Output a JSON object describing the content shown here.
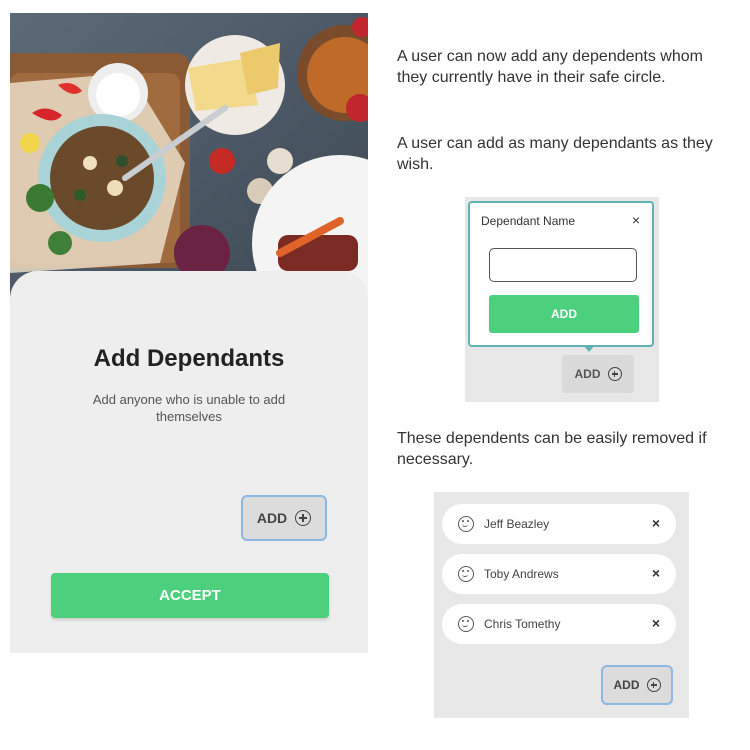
{
  "screen": {
    "title": "Add Dependants",
    "subtitle": "Add anyone who is unable to add themselves",
    "add_label": "ADD",
    "accept_label": "ACCEPT"
  },
  "notes": {
    "p1": "A user can now add any dependents whom they currently have in their safe circle.",
    "p2": "A user can add as many dependants as they wish.",
    "p3": "These dependents can be easily removed if necessary."
  },
  "dialog": {
    "title": "Dependant Name",
    "close": "×",
    "input_value": "",
    "add_label": "ADD",
    "behind_add_label": "ADD"
  },
  "dependents": {
    "items": [
      {
        "name": "Jeff Beazley",
        "remove": "×"
      },
      {
        "name": "Toby Andrews",
        "remove": "×"
      },
      {
        "name": "Chris Tomethy",
        "remove": "×"
      }
    ],
    "add_label": "ADD"
  },
  "colors": {
    "accent_green": "#4cd07d",
    "focus_blue": "#8fb7e3",
    "dialog_border": "#5fb3b3"
  },
  "icons": [
    "plus-circle-icon",
    "close-icon",
    "smiley-icon"
  ]
}
